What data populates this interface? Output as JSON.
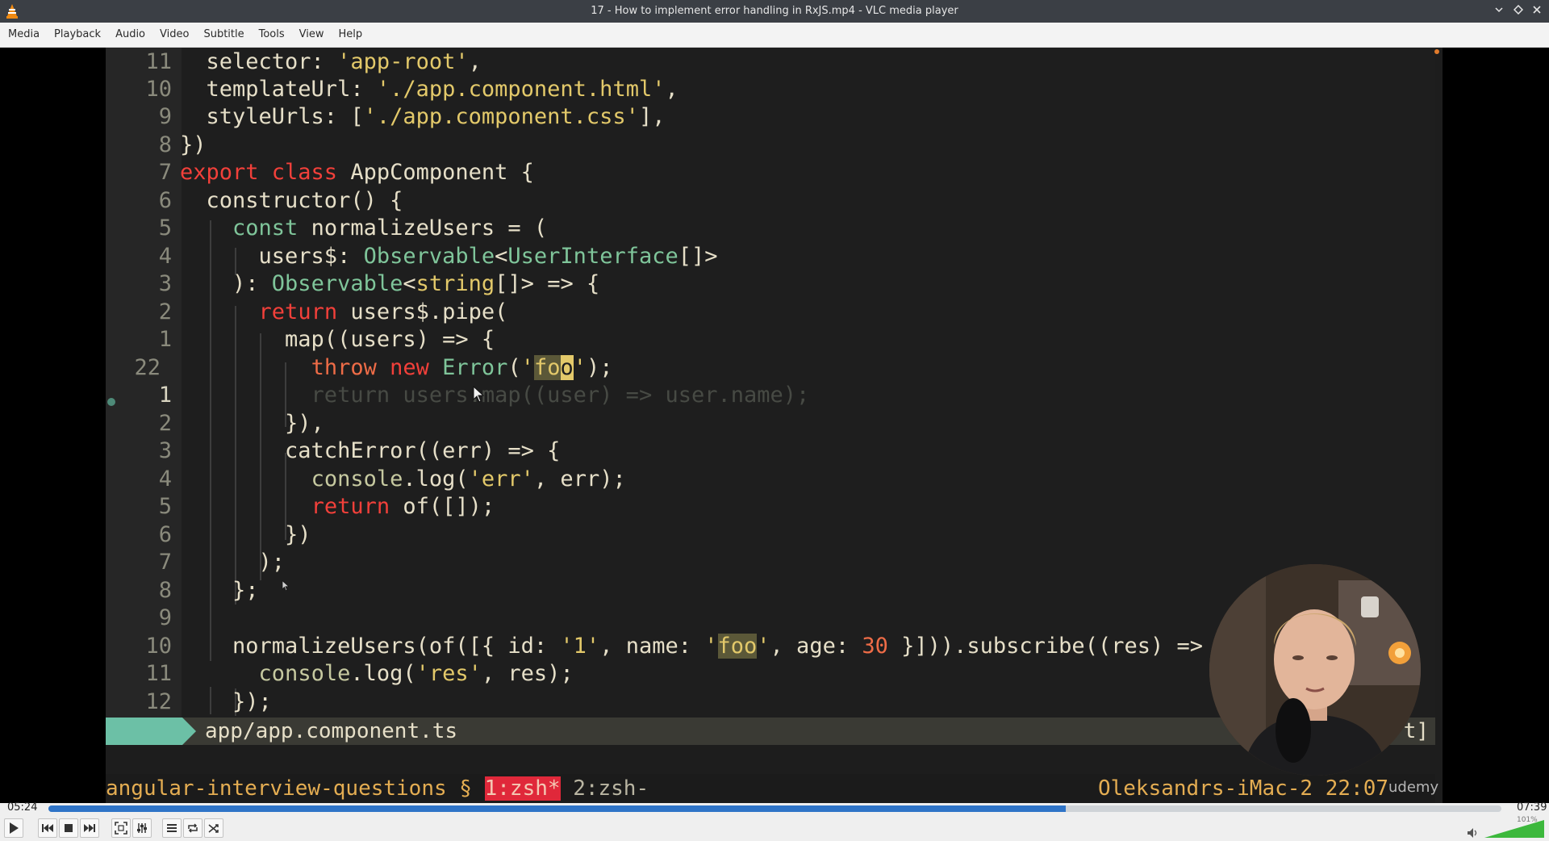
{
  "window": {
    "title": "17 - How to implement error handling in RxJS.mp4 - VLC media player",
    "controls": [
      "minimize-icon",
      "maximize-icon",
      "close-icon"
    ]
  },
  "menu": [
    "Media",
    "Playback",
    "Audio",
    "Video",
    "Subtitle",
    "Tools",
    "View",
    "Help"
  ],
  "editor": {
    "file": "app/app.component.ts",
    "status_right": "t]",
    "line_numbers": [
      "11",
      "10",
      "9",
      "8",
      "7",
      "6",
      "5",
      "4",
      "3",
      "2",
      "1",
      "22",
      "1",
      "2",
      "3",
      "4",
      "5",
      "6",
      "7",
      "8",
      "9",
      "10",
      "11",
      "12"
    ],
    "lines": [
      "  selector: 'app-root',",
      "  templateUrl: './app.component.html',",
      "  styleUrls: ['./app.component.css'],",
      "})",
      "export class AppComponent {",
      "  constructor() {",
      "    const normalizeUsers = (",
      "      users$: Observable<UserInterface[]>",
      "    ): Observable<string[]> => {",
      "      return users$.pipe(",
      "        map((users) => {",
      "          throw new Error('foo');",
      "          return users.map((user) => user.name);",
      "        }),",
      "        catchError((err) => {",
      "          console.log('err', err);",
      "          return of([]);",
      "        })",
      "      );",
      "    };",
      "",
      "    normalizeUsers(of([{ id: '1', name: 'foo', age: 30 }])).subscribe((res) => {",
      "      console.log('res', res);",
      "    });"
    ]
  },
  "tmux": {
    "session": "angular-interview-questions §",
    "window_active": "1:zsh*",
    "window_inactive": "2:zsh-",
    "host": "Oleksandrs-iMac-2 22:07"
  },
  "watermark": "udemy",
  "player": {
    "current_time": "05:24",
    "total_time": "07:39",
    "progress": 0.7,
    "volume_label": "101%",
    "volume": 1.01
  },
  "colors": {
    "accent": "#2f74c7",
    "mode": "#6cc0a6",
    "keyword": "#f2403a",
    "type": "#7fc59a",
    "string": "#e3c96a"
  }
}
